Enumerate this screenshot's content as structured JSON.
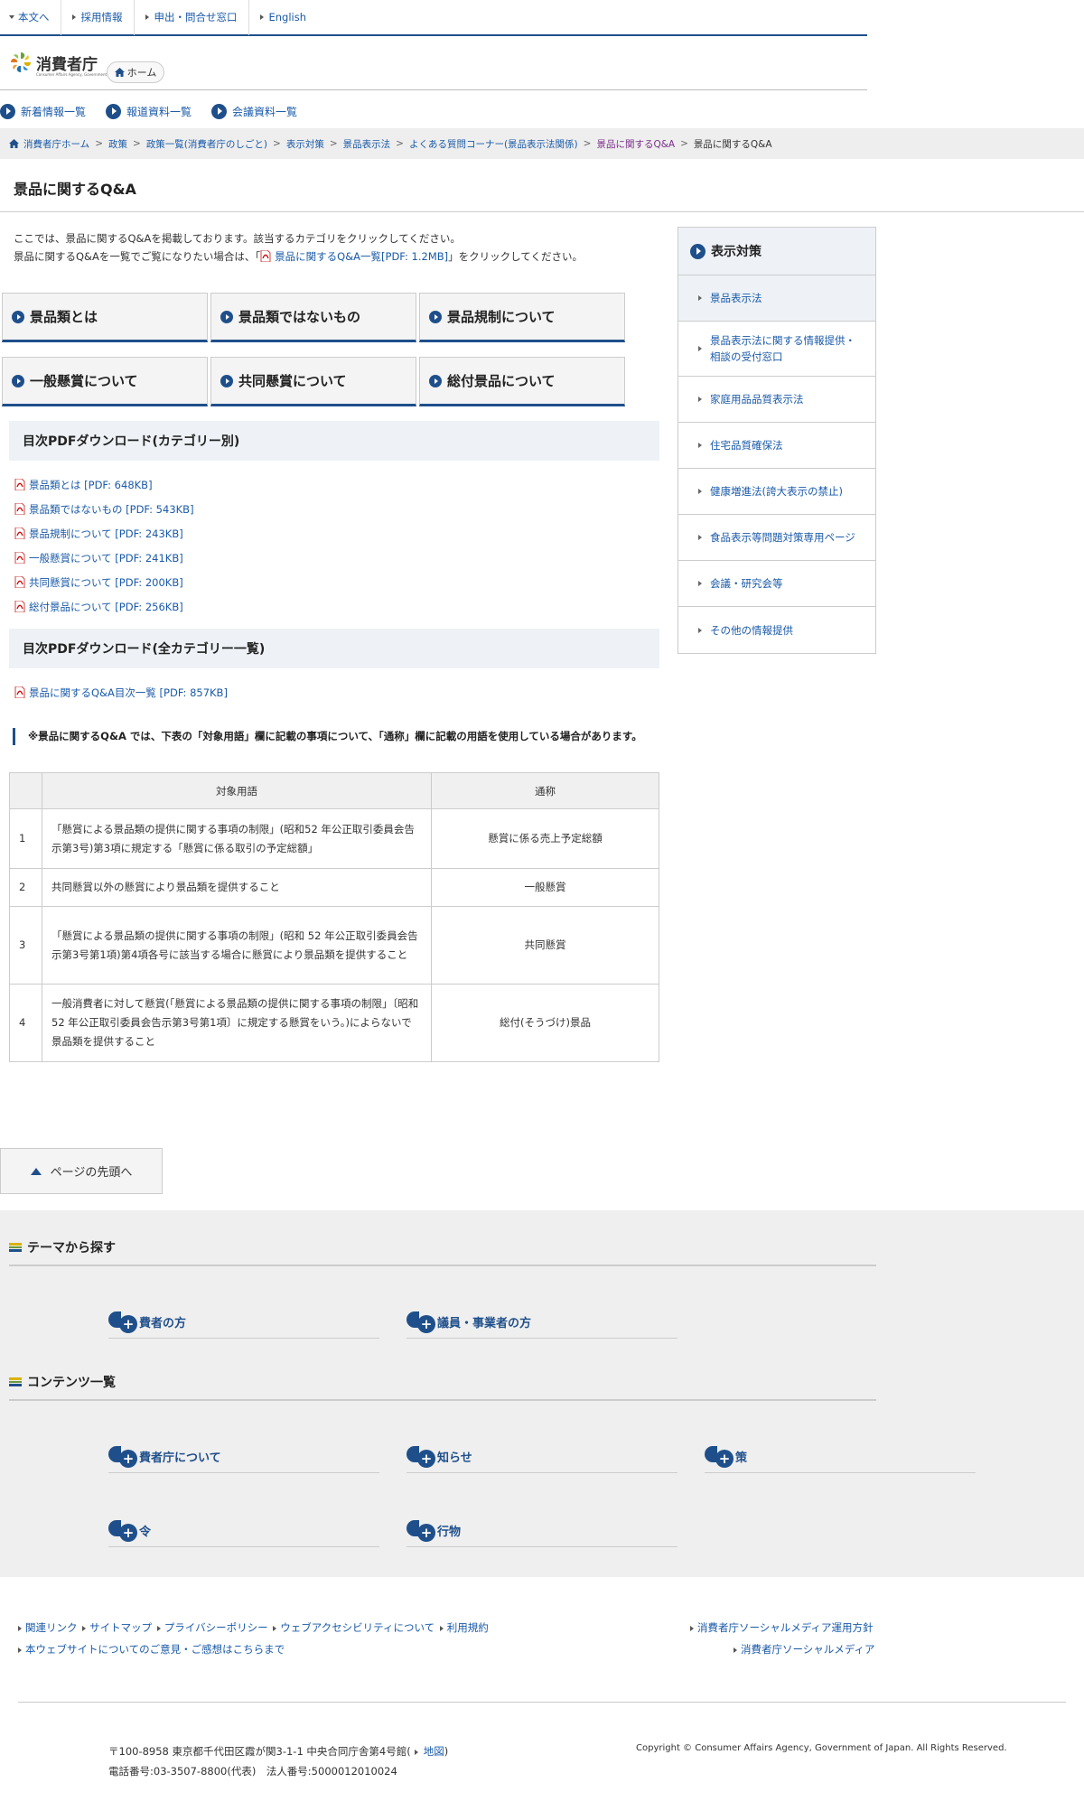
{
  "util_nav": {
    "main_text": "本文へ",
    "recruit": "採用情報",
    "contact": "申出・問合せ窓口",
    "english": "English"
  },
  "logo": {
    "name": "消費者庁",
    "sub": "Consumer Affairs Agency, Government of Japan"
  },
  "home_button": "ホーム",
  "news_nav": [
    "新着情報一覧",
    "報道資料一覧",
    "会議資料一覧"
  ],
  "breadcrumb": [
    "消費者庁ホーム",
    "政策",
    "政策一覧(消費者庁のしごと)",
    "表示対策",
    "景品表示法",
    "よくある質問コーナー(景品表示法関係)",
    "景品に関するQ&A",
    "景品に関するQ&A"
  ],
  "page_title": "景品に関するQ&A",
  "intro": {
    "line1": "ここでは、景品に関するQ&Aを掲載しております。該当するカテゴリをクリックしてください。",
    "line2_pre": "景品に関するQ&Aを一覧でご覧になりたい場合は、「",
    "line2_link": "景品に関するQ&A一覧[PDF: 1.2MB]",
    "line2_post": "」をクリックしてください。"
  },
  "categories": [
    "景品類とは",
    "景品類ではないもの",
    "景品規制について",
    "一般懸賞について",
    "共同懸賞について",
    "総付景品について"
  ],
  "section_category": "目次PDFダウンロード(カテゴリー別)",
  "category_pdfs": [
    "景品類とは [PDF: 648KB]",
    "景品類ではないもの [PDF: 543KB]",
    "景品規制について [PDF: 243KB]",
    "一般懸賞について [PDF: 241KB]",
    "共同懸賞について [PDF: 200KB]",
    "総付景品について [PDF: 256KB]"
  ],
  "section_all": "目次PDFダウンロード(全カテゴリー一覧)",
  "all_pdf": "景品に関するQ&A目次一覧 [PDF: 857KB]",
  "note": "※景品に関するQ&A では、下表の「対象用語」欄に記載の事項について、「通称」欄に記載の用語を使用している場合があります。",
  "table": {
    "headers": [
      "",
      "対象用語",
      "通称"
    ],
    "rows": [
      {
        "no": "1",
        "term": "「懸賞による景品類の提供に関する事項の制限」(昭和52 年公正取引委員会告示第3号)第3項に規定する「懸賞に係る取引の予定総額」",
        "alias": "懸賞に係る売上予定総額"
      },
      {
        "no": "2",
        "term": "共同懸賞以外の懸賞により景品類を提供すること",
        "alias": "一般懸賞"
      },
      {
        "no": "3",
        "term": "「懸賞による景品類の提供に関する事項の制限」(昭和 52 年公正取引委員会告示第3号第1項)第4項各号に該当する場合に懸賞により景品類を提供すること",
        "alias": "共同懸賞"
      },
      {
        "no": "4",
        "term": "一般消費者に対して懸賞(「懸賞による景品類の提供に関する事項の制限」〔昭和52 年公正取引委員会告示第3号第1項〕に規定する懸賞をいう。)によらないで景品類を提供すること",
        "alias": "総付(そうづけ)景品"
      }
    ]
  },
  "sidebar": {
    "title": "表示対策",
    "items": [
      "景品表示法",
      "景品表示法に関する情報提供・相談の受付窓口",
      "家庭用品品質表示法",
      "住宅品質確保法",
      "健康増進法(誇大表示の禁止)",
      "食品表示等問題対策専用ページ",
      "会議・研究会等",
      "その他の情報提供"
    ]
  },
  "to_top": "ページの先頭へ",
  "footer": {
    "theme_title": "テーマから探す",
    "theme_items": [
      "費者の方",
      "議員・事業者の方"
    ],
    "contents_title": "コンテンツ一覧",
    "contents_items": [
      "費者庁について",
      "知らせ",
      "策",
      "令",
      "行物"
    ],
    "links_row1": [
      "関連リンク",
      "サイトマップ",
      "プライバシーポリシー",
      "ウェブアクセシビリティについて",
      "利用規約"
    ],
    "links_row2": "本ウェブサイトについてのご意見・ご感想はこちらまで",
    "social1": "消費者庁ソーシャルメディア運用方針",
    "social2": "消費者庁ソーシャルメディア",
    "address1_pre": "〒100-8958 東京都千代田区霞が関3-1-1 中央合同庁舎第4号館(",
    "address1_link": "地図",
    "address1_post": ")",
    "address2": "電話番号:03-3507-8800(代表)　法人番号:5000012010024",
    "copyright": "Copyright © Consumer Affairs Agency, Government of Japan. All Rights Reserved."
  }
}
